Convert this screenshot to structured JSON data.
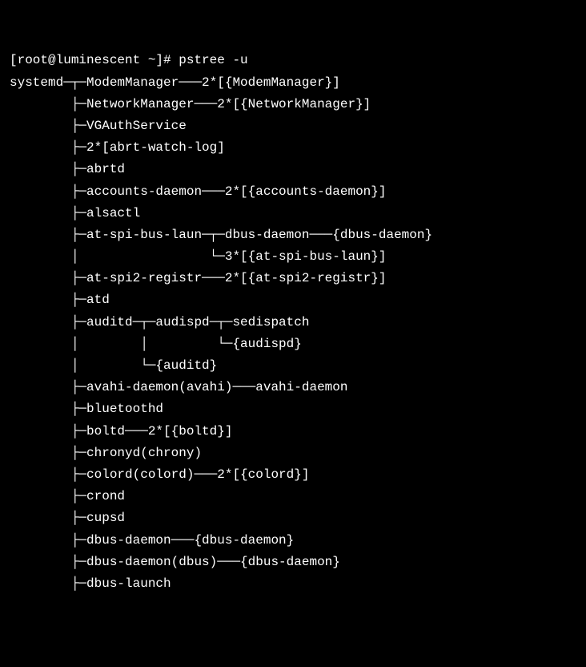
{
  "prompt": "[root@luminescent ~]# ",
  "command": "pstree -u",
  "lines": [
    "systemd─┬─ModemManager───2*[{ModemManager}]",
    "        ├─NetworkManager───2*[{NetworkManager}]",
    "        ├─VGAuthService",
    "        ├─2*[abrt-watch-log]",
    "        ├─abrtd",
    "        ├─accounts-daemon───2*[{accounts-daemon}]",
    "        ├─alsactl",
    "        ├─at-spi-bus-laun─┬─dbus-daemon───{dbus-daemon}",
    "        │                 └─3*[{at-spi-bus-laun}]",
    "        ├─at-spi2-registr───2*[{at-spi2-registr}]",
    "        ├─atd",
    "        ├─auditd─┬─audispd─┬─sedispatch",
    "        │        │         └─{audispd}",
    "        │        └─{auditd}",
    "        ├─avahi-daemon(avahi)───avahi-daemon",
    "        ├─bluetoothd",
    "        ├─boltd───2*[{boltd}]",
    "        ├─chronyd(chrony)",
    "        ├─colord(colord)───2*[{colord}]",
    "        ├─crond",
    "        ├─cupsd",
    "        ├─dbus-daemon───{dbus-daemon}",
    "        ├─dbus-daemon(dbus)───{dbus-daemon}",
    "        ├─dbus-launch"
  ]
}
